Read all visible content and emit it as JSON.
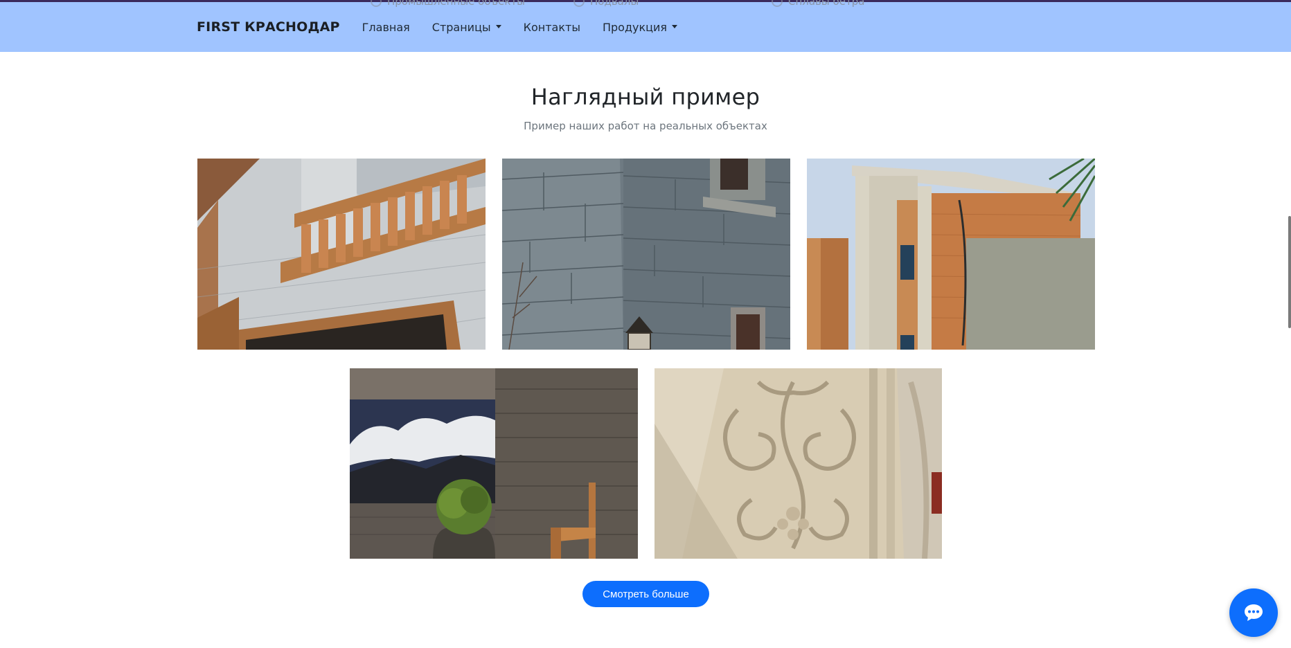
{
  "navbar": {
    "brand": "FIRST КРАСНОДАР",
    "links": [
      {
        "label": "Главная",
        "dropdown": false
      },
      {
        "label": "Страницы",
        "dropdown": true
      },
      {
        "label": "Контакты",
        "dropdown": false
      },
      {
        "label": "Продукция",
        "dropdown": true
      }
    ],
    "background": "#a0c4ff"
  },
  "peek_items": [
    "Промышленные объекты",
    "Подвалы",
    "Сплавы бетра"
  ],
  "section": {
    "title": "Наглядный пример",
    "subtitle": "Пример наших работ на реальных объектах"
  },
  "gallery": {
    "images": [
      {
        "name": "balcony-balustrade-photo"
      },
      {
        "name": "stone-wall-corner-photo"
      },
      {
        "name": "villa-facade-photo"
      },
      {
        "name": "terrace-wood-panels-photo"
      },
      {
        "name": "ornamental-relief-photo"
      }
    ]
  },
  "more_button": {
    "label": "Смотреть больше"
  },
  "chat_button": {
    "icon": "chat-bubble-icon"
  },
  "colors": {
    "accent": "#0d6efd",
    "subtitle": "#6c757d"
  }
}
